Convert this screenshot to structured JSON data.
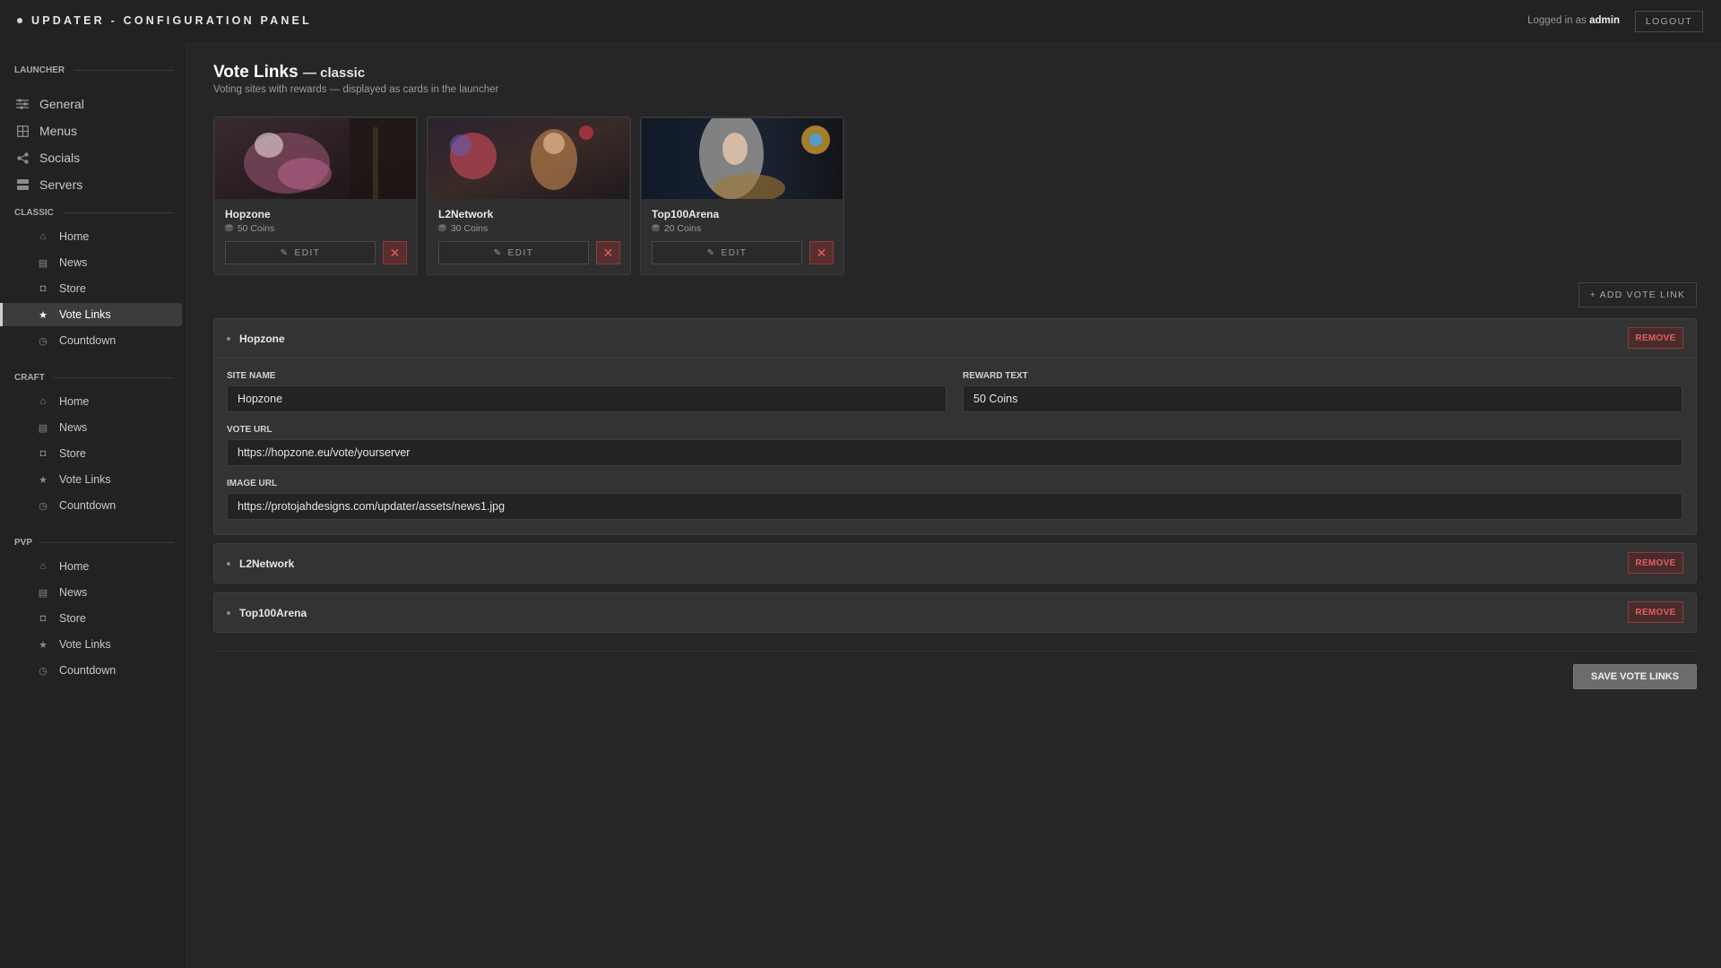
{
  "app": {
    "title": "UPDATER - CONFIGURATION PANEL"
  },
  "header": {
    "logged_prefix": "Logged in as ",
    "user": "admin",
    "logout_label": "LOGOUT"
  },
  "sidebar": {
    "launcher": {
      "heading": "LAUNCHER",
      "items": [
        "General",
        "Menus",
        "Socials",
        "Servers"
      ]
    },
    "sections": [
      {
        "heading": "CLASSIC",
        "items": [
          "Home",
          "News",
          "Store",
          "Vote Links",
          "Countdown"
        ]
      },
      {
        "heading": "CRAFT",
        "items": [
          "Home",
          "News",
          "Store",
          "Vote Links",
          "Countdown"
        ]
      },
      {
        "heading": "PVP",
        "items": [
          "Home",
          "News",
          "Store",
          "Vote Links",
          "Countdown"
        ]
      }
    ]
  },
  "page": {
    "title": "Vote Links",
    "title_suffix": "— classic",
    "subtitle": "Voting sites with rewards — displayed as cards in the launcher"
  },
  "cards": [
    {
      "name": "Hopzone",
      "reward": "50 Coins",
      "edit_label": "EDIT",
      "delete_label": "✕"
    },
    {
      "name": "L2Network",
      "reward": "30 Coins",
      "edit_label": "EDIT",
      "delete_label": "✕"
    },
    {
      "name": "Top100Arena",
      "reward": "20 Coins",
      "edit_label": "EDIT",
      "delete_label": "✕"
    }
  ],
  "add_label": "+ ADD VOTE LINK",
  "editor": {
    "items": [
      {
        "name": "Hopzone",
        "remove_label": "REMOVE"
      },
      {
        "name": "L2Network",
        "remove_label": "REMOVE"
      },
      {
        "name": "Top100Arena",
        "remove_label": "REMOVE"
      }
    ],
    "fields": {
      "site_name_label": "SITE NAME",
      "site_name": "Hopzone",
      "reward_label": "REWARD TEXT",
      "reward": "50 Coins",
      "url_label": "VOTE URL",
      "url": "https://hopzone.eu/vote/yourserver",
      "image_label": "IMAGE URL",
      "image": "https://protojahdesigns.com/updater/assets/news1.jpg"
    }
  },
  "save_label": "SAVE VOTE LINKS",
  "colors": {
    "background": "#262626",
    "sidebar": "#222222",
    "danger": "#e06060",
    "panel": "#333333"
  }
}
